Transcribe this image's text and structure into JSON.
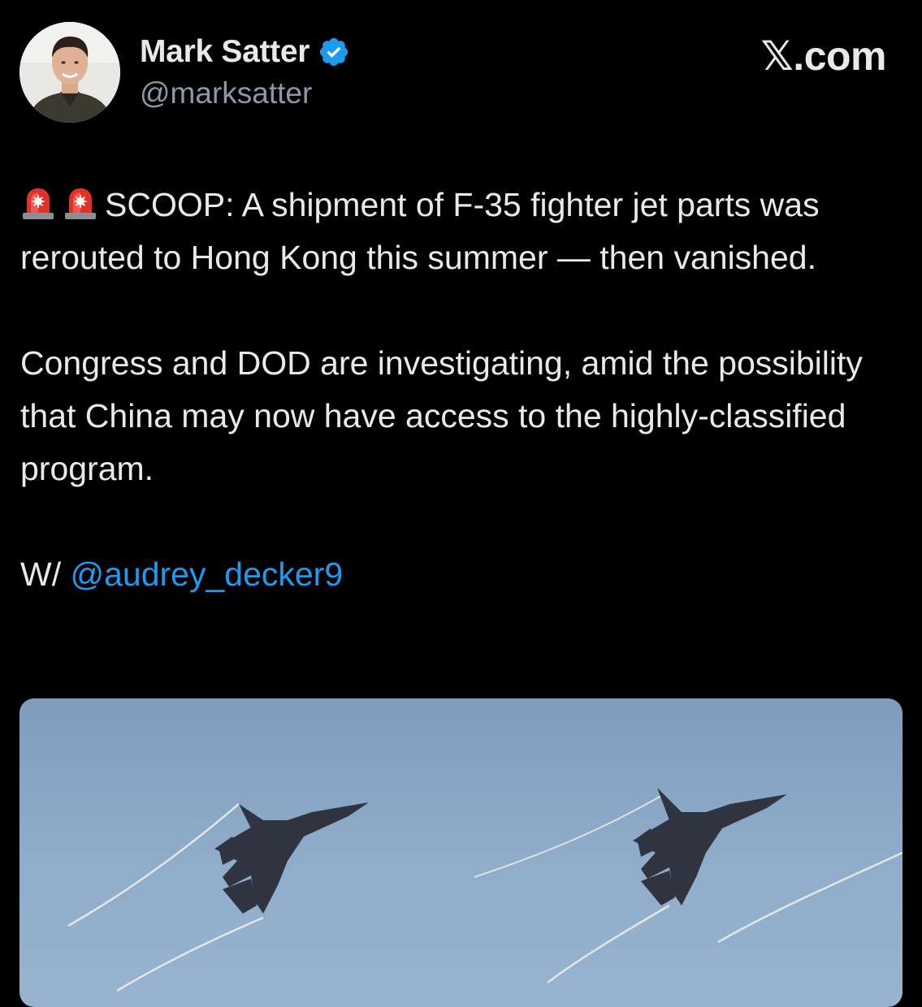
{
  "author": {
    "display_name": "Mark Satter",
    "handle": "@marksatter",
    "verified": true,
    "avatar_icon": "profile-photo"
  },
  "brand": {
    "site": "𝕏.com"
  },
  "tweet": {
    "emoji": [
      "police-car-light-icon",
      "police-car-light-icon"
    ],
    "line1": "SCOOP: A shipment of F-35 fighter jet parts was rerouted to Hong Kong this summer — then vanished.",
    "line2": "Congress and DOD are investigating, amid the possibility that China may now have access to the highly-classified program.",
    "line3_prefix": "W/ ",
    "mention": "@audrey_decker9"
  },
  "media": {
    "image_icon": "fighter-jets-photo"
  },
  "colors": {
    "background": "#000000",
    "text": "#e7e9ea",
    "secondary_text": "#8b98a5",
    "link": "#1d9bf0",
    "verified_badge": "#1d9bf0"
  }
}
